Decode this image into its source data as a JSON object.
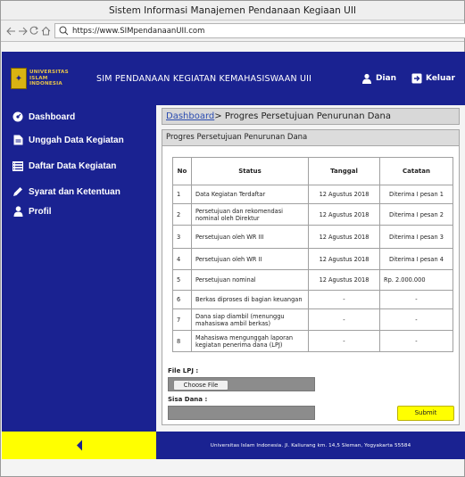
{
  "window": {
    "title": "Sistem Informasi Manajemen Pendanaan Kegiaan UII"
  },
  "browser": {
    "url": "https://www.SIMpendanaanUII.com"
  },
  "header": {
    "logo_lines": [
      "UNIVERSITAS",
      "ISLAM",
      "INDONESIA"
    ],
    "title": "SIM PENDANAAN KEGIATAN KEMAHASISWAAN UII",
    "user_label": "Dian",
    "logout_label": "Keluar"
  },
  "sidebar": {
    "items": [
      {
        "label": "Dashboard",
        "icon": "dashboard-icon"
      },
      {
        "label": "Unggah Data Kegiatan",
        "icon": "document-icon"
      },
      {
        "label": "Daftar Data Kegiatan",
        "icon": "list-icon"
      },
      {
        "label": "Syarat dan Ketentuan",
        "icon": "pencil-icon"
      },
      {
        "label": "Profil",
        "icon": "user-icon"
      }
    ]
  },
  "breadcrumb": {
    "link": "Dashboard",
    "separator": ">",
    "current": " Progres Persetujuan Penurunan Dana"
  },
  "panel": {
    "title": "Progres Persetujuan Penurunan Dana"
  },
  "table": {
    "columns": [
      "No",
      "Status",
      "Tanggal",
      "Catatan"
    ],
    "rows": [
      {
        "no": "1",
        "status": "Data Kegiatan Terdaftar",
        "tanggal": "12 Agustus 2018",
        "catatan": "Diterima I pesan 1"
      },
      {
        "no": "2",
        "status": "Persetujuan dan rekomendasi nominal oleh Direktur",
        "tanggal": "12 Agustus 2018",
        "catatan": "Diterima I pesan 2"
      },
      {
        "no": "3",
        "status": "Persetujuan oleh WR III",
        "tanggal": "12 Agustus 2018",
        "catatan": "Diterima I pesan 3"
      },
      {
        "no": "4",
        "status": "Persetujuan oleh WR II",
        "tanggal": "12 Agustus 2018",
        "catatan": "Diterima I pesan 4"
      },
      {
        "no": "5",
        "status": "Persetujuan nominal",
        "tanggal": "12 Agustus 2018",
        "catatan": "Rp. 2.000.000"
      },
      {
        "no": "6",
        "status": "Berkas diproses di bagian keuangan",
        "tanggal": "-",
        "catatan": "-"
      },
      {
        "no": "7",
        "status": "Dana siap diambil (menunggu mahasiswa ambil berkas)",
        "tanggal": "-",
        "catatan": "-"
      },
      {
        "no": "8",
        "status": "Mahasiswa mengunggah laporan kegiatan penerima dana (LPJ)",
        "tanggal": "-",
        "catatan": "-"
      }
    ]
  },
  "form": {
    "file_label": "File LPJ :",
    "choose_file_label": "Choose File",
    "sisa_label": "Sisa Dana :",
    "submit_label": "Submit"
  },
  "footer": {
    "text": "Universitas Islam Indonesia. Jl. Kaliurang km. 14,5 Sleman, Yogyakarta 55584"
  },
  "colors": {
    "navy": "#1a2291",
    "yellow": "#ffff00",
    "gold": "#d9b312"
  }
}
